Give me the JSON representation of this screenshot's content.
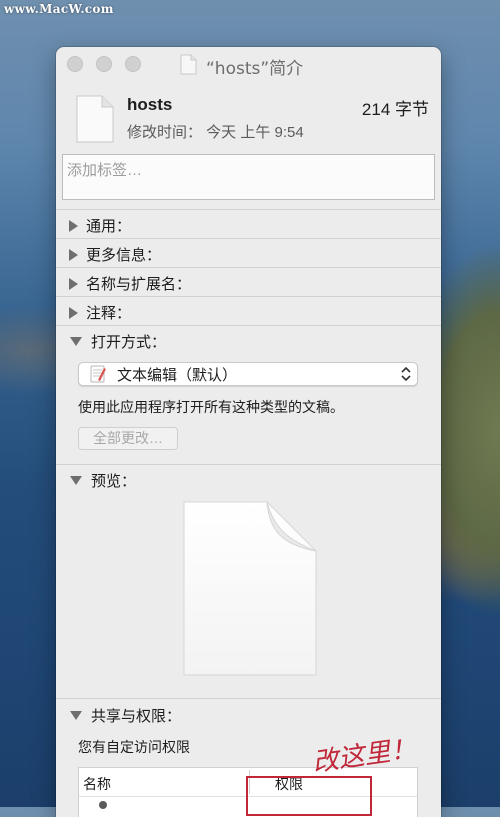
{
  "watermark": "www.MacW.com",
  "window": {
    "title": "“hosts”简介"
  },
  "file": {
    "name": "hosts",
    "size": "214 字节",
    "modified": "修改时间： 今天 上午 9:54"
  },
  "tags": {
    "placeholder": "添加标签…"
  },
  "sections": {
    "general": "通用：",
    "more_info": "更多信息：",
    "name_ext": "名称与扩展名：",
    "comments": "注释：",
    "open_with": "打开方式：",
    "preview": "预览：",
    "sharing": "共享与权限："
  },
  "open_with": {
    "app": "文本编辑（默认）",
    "description": "使用此应用程序打开所有这种类型的文稿。",
    "change_all_label": "全部更改…"
  },
  "sharing": {
    "custom_access": "您有自定访问权限",
    "columns": {
      "name": "名称",
      "privilege": "权限"
    }
  },
  "annotation": {
    "text": "改这里！",
    "color": "#c0283a"
  },
  "icons": [
    "doc-icon",
    "textedit-icon",
    "updown-chevron-icon",
    "disclosure-triangle-icon"
  ]
}
